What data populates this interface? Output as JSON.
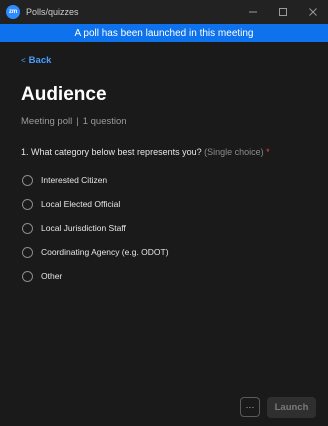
{
  "window": {
    "app_icon_text": "zm",
    "title": "Polls/quizzes",
    "minimize_icon": "minimize-icon",
    "maximize_icon": "maximize-icon",
    "close_icon": "close-icon"
  },
  "banner": {
    "text": "A poll has been launched in this meeting",
    "color": "#0e72ed"
  },
  "nav": {
    "back_chevron": "<",
    "back_label": "Back"
  },
  "poll": {
    "title": "Audience",
    "type": "Meeting poll",
    "separator": "|",
    "question_count": "1 question"
  },
  "question": {
    "text": "1. What category below best represents you?",
    "hint": "(Single choice)",
    "required_mark": "*",
    "options": [
      "Interested Citizen",
      "Local Elected Official",
      "Local Jurisdiction Staff",
      "Coordinating Agency (e.g. ODOT)",
      "Other"
    ]
  },
  "footer": {
    "more_label": "···",
    "launch_label": "Launch"
  },
  "colors": {
    "background": "#1a1a1a",
    "accent": "#4a9cff",
    "required": "#e54b4b"
  }
}
